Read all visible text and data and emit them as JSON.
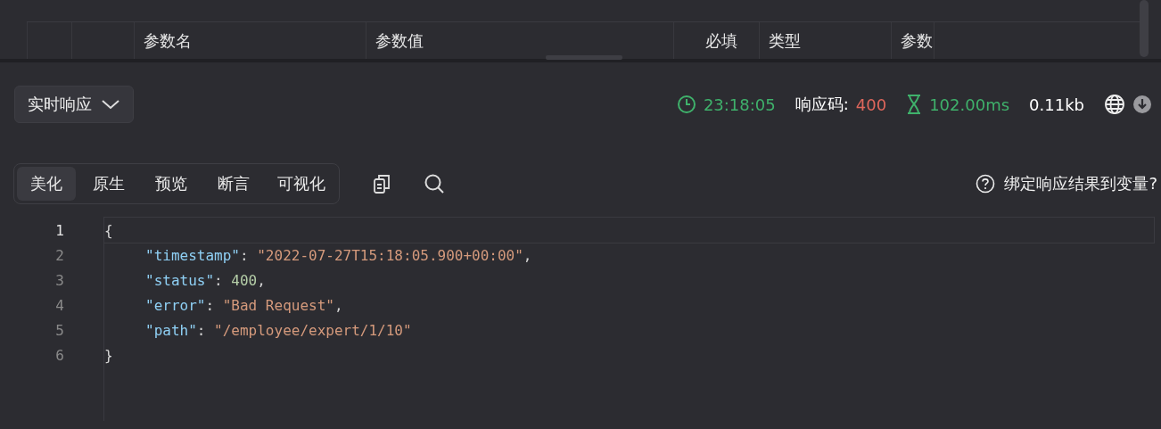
{
  "params_table": {
    "columns": [
      {
        "label": "参数名"
      },
      {
        "label": "参数值"
      },
      {
        "label": "必填"
      },
      {
        "label": "类型"
      },
      {
        "label": "参数"
      }
    ]
  },
  "response_bar": {
    "mode": "实时响应",
    "time": "23:18:05",
    "status_label": "响应码:",
    "status_code": "400",
    "duration": "102.00ms",
    "size": "0.11kb"
  },
  "view_tabs": [
    {
      "label": "美化",
      "selected": true
    },
    {
      "label": "原生",
      "selected": false
    },
    {
      "label": "预览",
      "selected": false
    },
    {
      "label": "断言",
      "selected": false
    },
    {
      "label": "可视化",
      "selected": false
    }
  ],
  "bind_link": "绑定响应结果到变量?",
  "code_lines": [
    {
      "number": "1",
      "tokens": [
        {
          "kind": "punct",
          "text": "{"
        }
      ],
      "children": [
        {
          "number": "2",
          "tokens": [
            {
              "kind": "key",
              "text": "\"timestamp\""
            },
            {
              "kind": "punct",
              "text": ": "
            },
            {
              "kind": "string",
              "text": "\"2022-07-27T15:18:05.900+00:00\""
            },
            {
              "kind": "punct",
              "text": ","
            }
          ]
        },
        {
          "number": "3",
          "tokens": [
            {
              "kind": "key",
              "text": "\"status\""
            },
            {
              "kind": "punct",
              "text": ": "
            },
            {
              "kind": "number",
              "text": "400"
            },
            {
              "kind": "punct",
              "text": ","
            }
          ]
        },
        {
          "number": "4",
          "tokens": [
            {
              "kind": "key",
              "text": "\"error\""
            },
            {
              "kind": "punct",
              "text": ": "
            },
            {
              "kind": "string",
              "text": "\"Bad Request\""
            },
            {
              "kind": "punct",
              "text": ","
            }
          ]
        },
        {
          "number": "5",
          "tokens": [
            {
              "kind": "key",
              "text": "\"path\""
            },
            {
              "kind": "punct",
              "text": ": "
            },
            {
              "kind": "string",
              "text": "\"/employee/expert/1/10\""
            }
          ]
        }
      ]
    },
    {
      "number": "6",
      "tokens": [
        {
          "kind": "punct",
          "text": "}"
        }
      ]
    }
  ]
}
